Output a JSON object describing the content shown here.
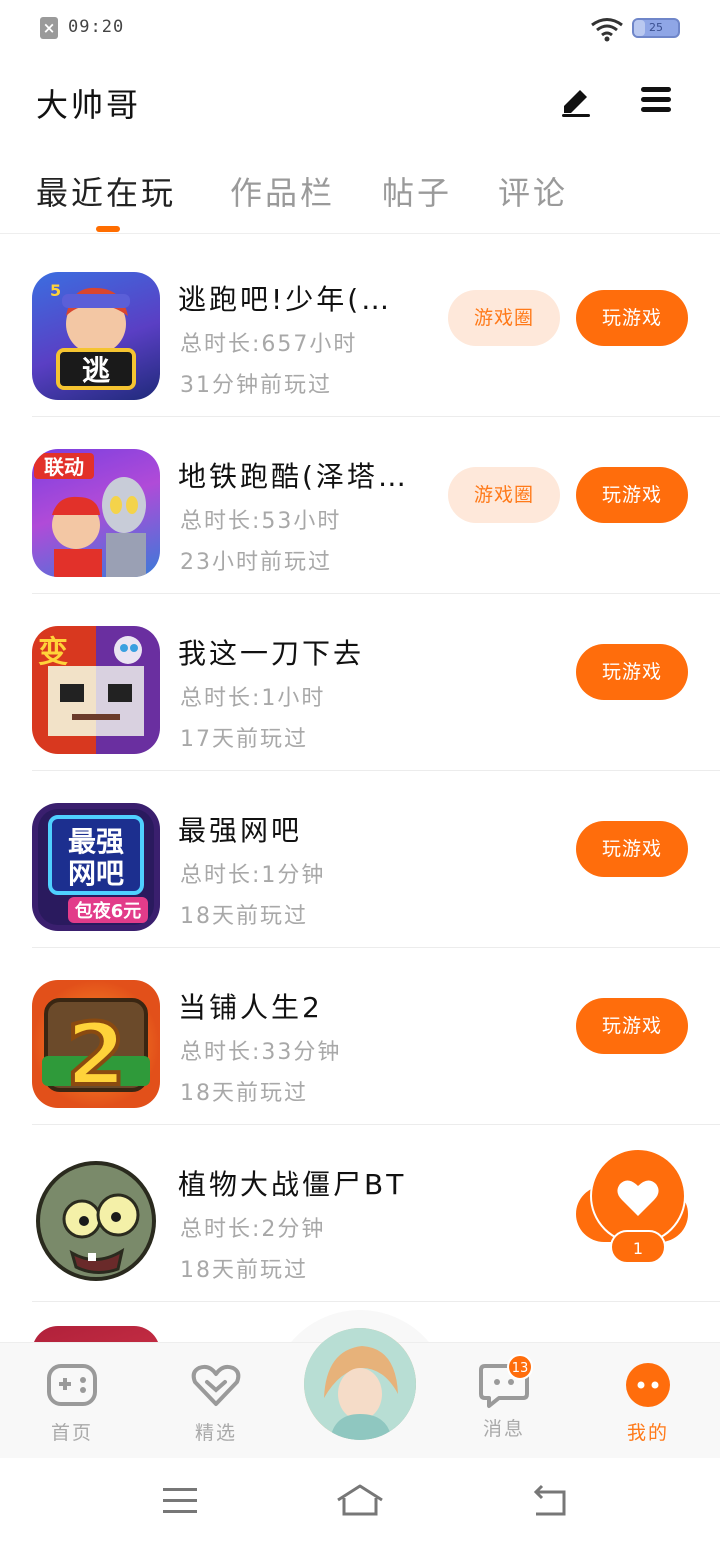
{
  "status_bar": {
    "time": "09:20",
    "battery_level": 25,
    "battery_text": "25"
  },
  "header": {
    "title": "大帅哥",
    "edit_icon": "pencil-icon",
    "menu_icon": "hamburger-menu-icon"
  },
  "tabs": [
    {
      "label": "最近在玩",
      "active": true
    },
    {
      "label": "作品栏",
      "active": false
    },
    {
      "label": "帖子",
      "active": false
    },
    {
      "label": "评论",
      "active": false
    }
  ],
  "games": [
    {
      "name": "逃跑吧!少年(…",
      "duration": "总时长:657小时",
      "last_played": "31分钟前玩过",
      "circle_button": "游戏圈",
      "play_button": "玩游戏",
      "icon": "escape-boy-game-icon"
    },
    {
      "name": "地铁跑酷(泽塔…",
      "duration": "总时长:53小时",
      "last_played": "23小时前玩过",
      "circle_button": "游戏圈",
      "play_button": "玩游戏",
      "icon": "subway-surfers-game-icon"
    },
    {
      "name": "我这一刀下去",
      "duration": "总时长:1小时",
      "last_played": "17天前玩过",
      "circle_button": "",
      "play_button": "玩游戏",
      "icon": "blade-game-icon"
    },
    {
      "name": "最强网吧",
      "duration": "总时长:1分钟",
      "last_played": "18天前玩过",
      "circle_button": "",
      "play_button": "玩游戏",
      "icon": "internet-cafe-game-icon"
    },
    {
      "name": "当铺人生2",
      "duration": "总时长:33分钟",
      "last_played": "18天前玩过",
      "circle_button": "",
      "play_button": "玩游戏",
      "icon": "pawn-shop-game-icon"
    },
    {
      "name": "植物大战僵尸BT",
      "duration": "总时长:2分钟",
      "last_played": "18天前玩过",
      "circle_button": "",
      "play_button": "",
      "icon": "zombie-game-icon"
    }
  ],
  "floating_like": {
    "count": "1",
    "icon": "heart-icon"
  },
  "bottom_nav": {
    "home_label": "首页",
    "featured_label": "精选",
    "messages_label": "消息",
    "messages_badge": "13",
    "mine_label": "我的"
  },
  "colors": {
    "accent": "#ff6d0c",
    "accent_light": "#fee8da",
    "text_secondary": "#a8a8a8"
  }
}
